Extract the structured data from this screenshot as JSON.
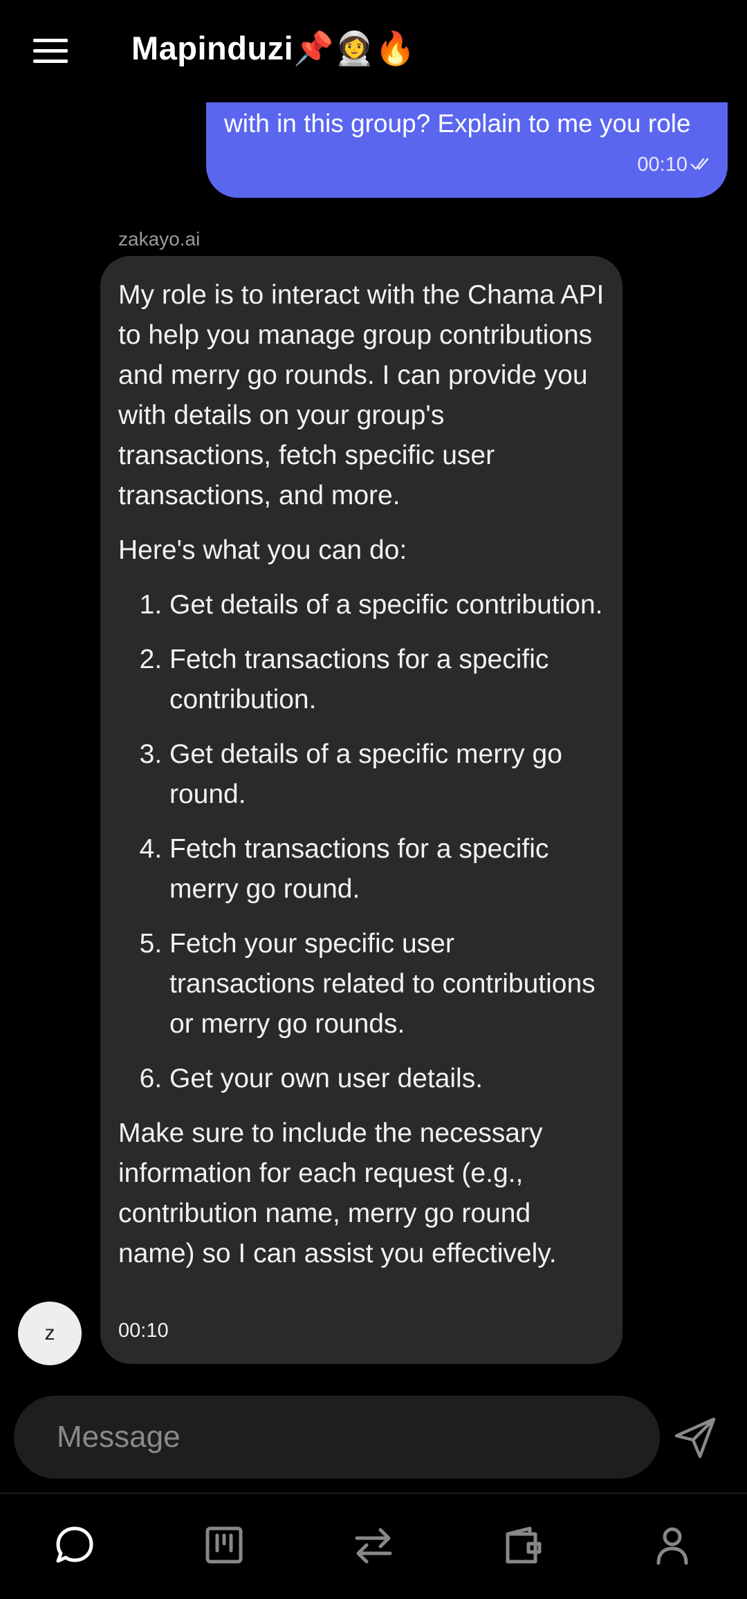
{
  "header": {
    "title": "Mapinduzi📌👩‍🚀🔥"
  },
  "messages": {
    "outgoing": {
      "text": "with in this group? Explain to me you role",
      "time": "00:10"
    },
    "incoming": {
      "sender": "zakayo.ai",
      "intro": "My role is to interact with the Chama API to help you manage group contributions and merry go rounds. I can provide you with details on your group's transactions, fetch specific user transactions, and more.",
      "list_heading": "Here's what you can do:",
      "items": [
        "Get details of a specific contribution.",
        "Fetch transactions for a specific contribution.",
        "Get details of a specific merry go round.",
        "Fetch transactions for a specific merry go round.",
        "Fetch your specific user transactions related to contributions or merry go rounds.",
        "Get your own user details."
      ],
      "outro": "Make sure to include the necessary information for each request (e.g., contribution name, merry go round name) so I can assist you effectively.",
      "time": "00:10",
      "avatar_letter": "z"
    }
  },
  "composer": {
    "placeholder": "Message"
  },
  "nav": {
    "items": [
      "chat-icon",
      "board-icon",
      "transfer-icon",
      "wallet-icon",
      "profile-icon"
    ]
  },
  "colors": {
    "outgoing_bubble": "#5b66ef",
    "incoming_bubble": "#2a2a2c",
    "background": "#000000"
  }
}
